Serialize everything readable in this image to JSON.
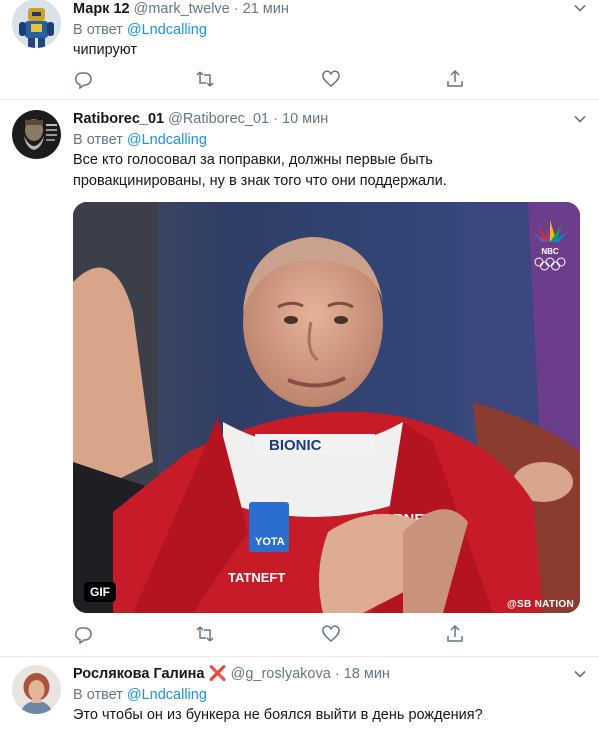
{
  "tweets": [
    {
      "name": "Марк 12",
      "handle": "@mark_twelve",
      "separator": "·",
      "time": "21 мин",
      "reply_prefix": "В ответ",
      "reply_to": "@Lndcalling",
      "text": "чипируют",
      "avatar_icon": "robot-avatar"
    },
    {
      "name": "Ratiborec_01",
      "handle": "@Ratiborec_01",
      "separator": "·",
      "time": "10 мин",
      "reply_prefix": "В ответ",
      "reply_to": "@Lndcalling",
      "text_line1": "Все кто голосовал за поправки, должны первые быть",
      "text_line2": "провакцинированы, ну в знак того что они поддержали.",
      "avatar_icon": "bearded-man-avatar",
      "media": {
        "badge": "GIF",
        "watermark": "@SB NATION",
        "logo_text": "NBC",
        "jacket_texts": [
          "BIONIC",
          "YOTA",
          "TATNEFT",
          "VARNET",
          "ering"
        ]
      }
    },
    {
      "name": "Рослякова Галина",
      "flag": "❌",
      "handle": "@g_roslyakova",
      "separator": "·",
      "time": "18 мин",
      "reply_prefix": "В ответ",
      "reply_to": "@Lndcalling",
      "text": "Это чтобы он из бункера не боялся выйти в день рождения?",
      "avatar_icon": "woman-avatar"
    }
  ],
  "icons": {
    "reply": "reply-icon",
    "retweet": "retweet-icon",
    "like": "heart-icon",
    "share": "share-icon",
    "caret": "chevron-down-icon"
  },
  "colors": {
    "link": "#1b95e0",
    "muted": "#657786",
    "text": "#14171a",
    "divider": "#e6ecf0"
  }
}
